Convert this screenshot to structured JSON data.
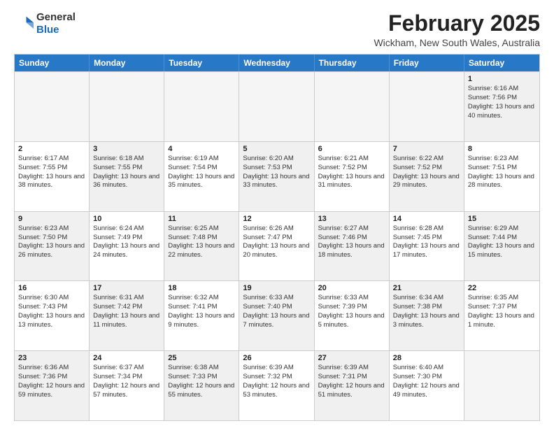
{
  "header": {
    "logo_general": "General",
    "logo_blue": "Blue",
    "month_title": "February 2025",
    "location": "Wickham, New South Wales, Australia"
  },
  "weekdays": [
    "Sunday",
    "Monday",
    "Tuesday",
    "Wednesday",
    "Thursday",
    "Friday",
    "Saturday"
  ],
  "rows": [
    [
      {
        "day": "",
        "text": "",
        "empty": true
      },
      {
        "day": "",
        "text": "",
        "empty": true
      },
      {
        "day": "",
        "text": "",
        "empty": true
      },
      {
        "day": "",
        "text": "",
        "empty": true
      },
      {
        "day": "",
        "text": "",
        "empty": true
      },
      {
        "day": "",
        "text": "",
        "empty": true
      },
      {
        "day": "1",
        "text": "Sunrise: 6:16 AM\nSunset: 7:56 PM\nDaylight: 13 hours and 40 minutes.",
        "shaded": true
      }
    ],
    [
      {
        "day": "2",
        "text": "Sunrise: 6:17 AM\nSunset: 7:55 PM\nDaylight: 13 hours and 38 minutes."
      },
      {
        "day": "3",
        "text": "Sunrise: 6:18 AM\nSunset: 7:55 PM\nDaylight: 13 hours and 36 minutes.",
        "shaded": true
      },
      {
        "day": "4",
        "text": "Sunrise: 6:19 AM\nSunset: 7:54 PM\nDaylight: 13 hours and 35 minutes."
      },
      {
        "day": "5",
        "text": "Sunrise: 6:20 AM\nSunset: 7:53 PM\nDaylight: 13 hours and 33 minutes.",
        "shaded": true
      },
      {
        "day": "6",
        "text": "Sunrise: 6:21 AM\nSunset: 7:52 PM\nDaylight: 13 hours and 31 minutes."
      },
      {
        "day": "7",
        "text": "Sunrise: 6:22 AM\nSunset: 7:52 PM\nDaylight: 13 hours and 29 minutes.",
        "shaded": true
      },
      {
        "day": "8",
        "text": "Sunrise: 6:23 AM\nSunset: 7:51 PM\nDaylight: 13 hours and 28 minutes."
      }
    ],
    [
      {
        "day": "9",
        "text": "Sunrise: 6:23 AM\nSunset: 7:50 PM\nDaylight: 13 hours and 26 minutes.",
        "shaded": true
      },
      {
        "day": "10",
        "text": "Sunrise: 6:24 AM\nSunset: 7:49 PM\nDaylight: 13 hours and 24 minutes."
      },
      {
        "day": "11",
        "text": "Sunrise: 6:25 AM\nSunset: 7:48 PM\nDaylight: 13 hours and 22 minutes.",
        "shaded": true
      },
      {
        "day": "12",
        "text": "Sunrise: 6:26 AM\nSunset: 7:47 PM\nDaylight: 13 hours and 20 minutes."
      },
      {
        "day": "13",
        "text": "Sunrise: 6:27 AM\nSunset: 7:46 PM\nDaylight: 13 hours and 18 minutes.",
        "shaded": true
      },
      {
        "day": "14",
        "text": "Sunrise: 6:28 AM\nSunset: 7:45 PM\nDaylight: 13 hours and 17 minutes."
      },
      {
        "day": "15",
        "text": "Sunrise: 6:29 AM\nSunset: 7:44 PM\nDaylight: 13 hours and 15 minutes.",
        "shaded": true
      }
    ],
    [
      {
        "day": "16",
        "text": "Sunrise: 6:30 AM\nSunset: 7:43 PM\nDaylight: 13 hours and 13 minutes."
      },
      {
        "day": "17",
        "text": "Sunrise: 6:31 AM\nSunset: 7:42 PM\nDaylight: 13 hours and 11 minutes.",
        "shaded": true
      },
      {
        "day": "18",
        "text": "Sunrise: 6:32 AM\nSunset: 7:41 PM\nDaylight: 13 hours and 9 minutes."
      },
      {
        "day": "19",
        "text": "Sunrise: 6:33 AM\nSunset: 7:40 PM\nDaylight: 13 hours and 7 minutes.",
        "shaded": true
      },
      {
        "day": "20",
        "text": "Sunrise: 6:33 AM\nSunset: 7:39 PM\nDaylight: 13 hours and 5 minutes."
      },
      {
        "day": "21",
        "text": "Sunrise: 6:34 AM\nSunset: 7:38 PM\nDaylight: 13 hours and 3 minutes.",
        "shaded": true
      },
      {
        "day": "22",
        "text": "Sunrise: 6:35 AM\nSunset: 7:37 PM\nDaylight: 13 hours and 1 minute."
      }
    ],
    [
      {
        "day": "23",
        "text": "Sunrise: 6:36 AM\nSunset: 7:36 PM\nDaylight: 12 hours and 59 minutes.",
        "shaded": true
      },
      {
        "day": "24",
        "text": "Sunrise: 6:37 AM\nSunset: 7:34 PM\nDaylight: 12 hours and 57 minutes."
      },
      {
        "day": "25",
        "text": "Sunrise: 6:38 AM\nSunset: 7:33 PM\nDaylight: 12 hours and 55 minutes.",
        "shaded": true
      },
      {
        "day": "26",
        "text": "Sunrise: 6:39 AM\nSunset: 7:32 PM\nDaylight: 12 hours and 53 minutes."
      },
      {
        "day": "27",
        "text": "Sunrise: 6:39 AM\nSunset: 7:31 PM\nDaylight: 12 hours and 51 minutes.",
        "shaded": true
      },
      {
        "day": "28",
        "text": "Sunrise: 6:40 AM\nSunset: 7:30 PM\nDaylight: 12 hours and 49 minutes."
      },
      {
        "day": "",
        "text": "",
        "empty": true
      }
    ]
  ]
}
